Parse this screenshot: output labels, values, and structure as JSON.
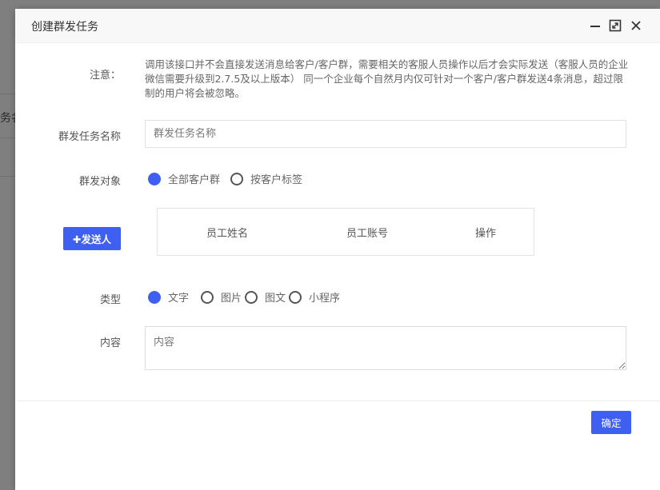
{
  "background": {
    "partial_text": "务名"
  },
  "dialog": {
    "title": "创建群发任务",
    "notice": {
      "label": "注意：",
      "text": "调用该接口并不会直接发送消息给客户/客户群，需要相关的客服人员操作以后才会实际发送（客服人员的企业微信需要升级到2.7.5及以上版本） 同一个企业每个自然月内仅可针对一个客户/客户群发送4条消息，超过限制的用户将会被忽略。"
    },
    "task_name": {
      "label": "群发任务名称",
      "placeholder": "群发任务名称",
      "value": ""
    },
    "target": {
      "label": "群发对象",
      "options": [
        "全部客户群",
        "按客户标签"
      ],
      "selected": "全部客户群"
    },
    "sender": {
      "button_label": "✚发送人",
      "columns": [
        "员工姓名",
        "员工账号",
        "操作"
      ]
    },
    "type": {
      "label": "类型",
      "options": [
        "文字",
        "图片",
        "图文",
        "小程序"
      ],
      "selected": "文字"
    },
    "content": {
      "label": "内容",
      "placeholder": "内容",
      "value": ""
    },
    "confirm_label": "确定"
  },
  "colors": {
    "accent": "#3f5ff0",
    "overlay": "#7f7f7f"
  }
}
